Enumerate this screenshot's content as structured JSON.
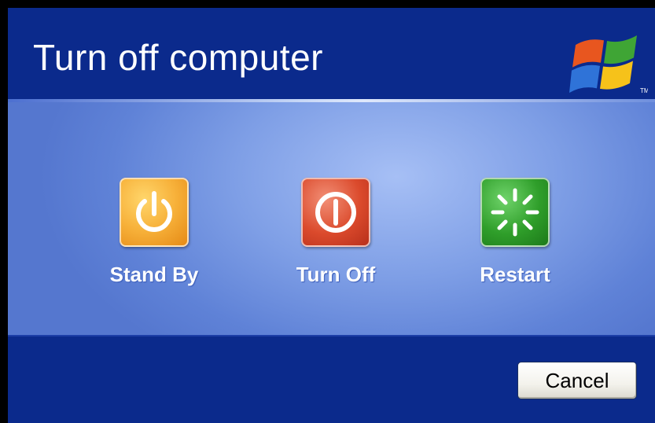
{
  "dialog": {
    "title": "Turn off computer",
    "logo_icon": "windows-xp-flag-logo"
  },
  "options": [
    {
      "label": "Stand By",
      "icon": "power-icon",
      "color": "#f7b13a"
    },
    {
      "label": "Turn Off",
      "icon": "power-off-icon",
      "color": "#db4a2c"
    },
    {
      "label": "Restart",
      "icon": "restart-icon",
      "color": "#2f9e2a"
    }
  ],
  "footer": {
    "cancel_label": "Cancel"
  },
  "colors": {
    "header_background": "#0b2a8c",
    "panel_background": "#7f9fe6",
    "text": "#ffffff"
  }
}
